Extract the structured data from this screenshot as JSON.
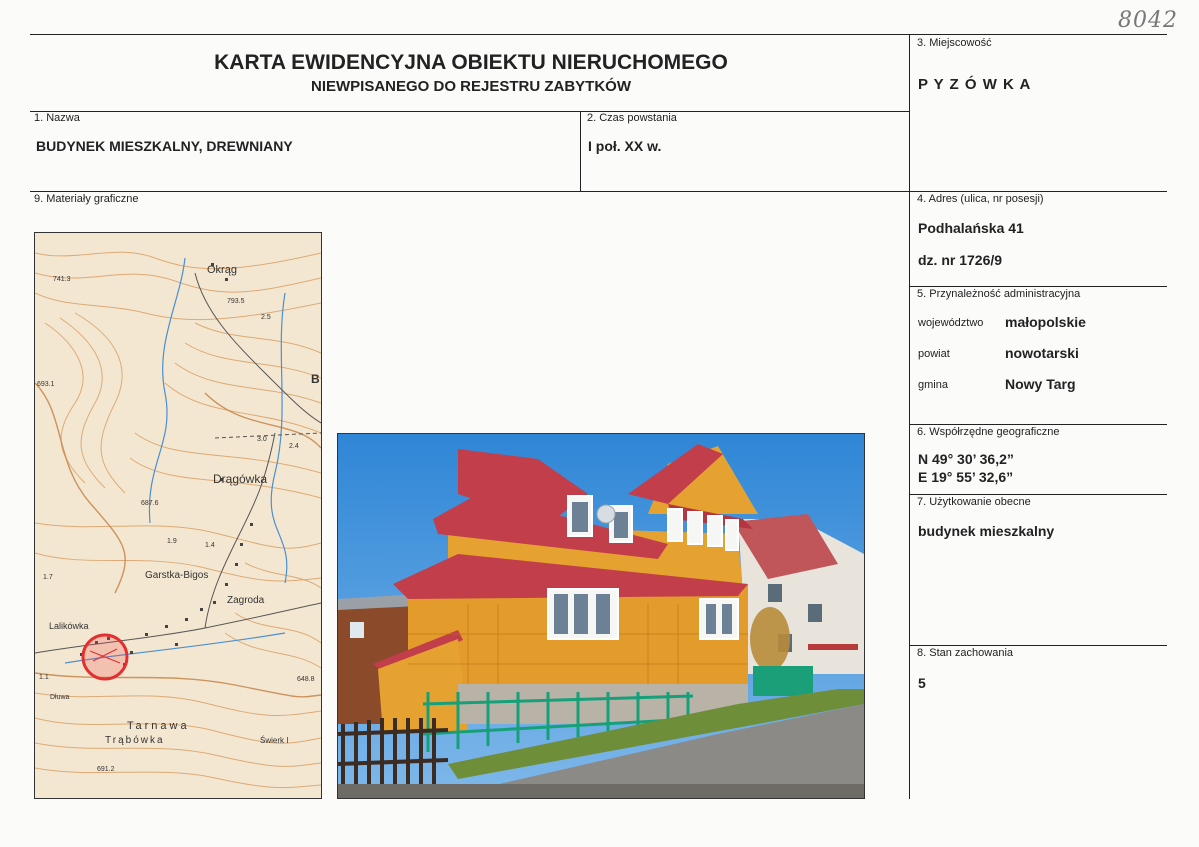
{
  "handwritten_number": "8042",
  "header": {
    "title_line1": "KARTA EWIDENCYJNA OBIEKTU NIERUCHOMEGO",
    "title_line2": "NIEWPISANEGO DO REJESTRU ZABYTKÓW"
  },
  "fields": {
    "nazwa": {
      "label": "1. Nazwa",
      "value": "BUDYNEK MIESZKALNY, DREWNIANY"
    },
    "czas": {
      "label": "2. Czas powstania",
      "value": "I poł. XX w."
    },
    "miejscowosc": {
      "label": "3. Miejscowość",
      "value": "P Y Z Ó W K A"
    },
    "adres": {
      "label": "4. Adres (ulica, nr posesji)",
      "line1": "Podhalańska 41",
      "line2": "dz. nr 1726/9"
    },
    "przynaleznosc": {
      "label": "5. Przynależność administracyjna",
      "rows": [
        {
          "key": "województwo",
          "value": "małopolskie"
        },
        {
          "key": "powiat",
          "value": "nowotarski"
        },
        {
          "key": "gmina",
          "value": "Nowy Targ"
        }
      ]
    },
    "wspolrzedne": {
      "label": "6. Współrzędne geograficzne",
      "n": "N 49° 30’ 36,2”",
      "e": "E 19° 55’ 32,6”"
    },
    "uzytkowanie": {
      "label": "7. Użytkowanie obecne",
      "value": "budynek mieszkalny"
    },
    "stan": {
      "label": "8. Stan zachowania",
      "value": "5"
    },
    "materialy": {
      "label": "9. Materiały graficzne"
    }
  },
  "map": {
    "place_labels": [
      "Okrąg",
      "Drągówka",
      "Garstka-Bigos",
      "Zagroda",
      "Lalikówka",
      "Tarnawa",
      "Trąbówka",
      "Świerk I",
      "Dłuwa"
    ],
    "numbers": [
      "741.3",
      "793.5",
      "2.5",
      "693.1",
      "3.0",
      "2.4",
      "687.6",
      "1.9",
      "1.4",
      "1.7",
      "648.8",
      "691.2",
      "1.1"
    ],
    "colors": {
      "contour": "#d9a066",
      "water": "#4a8fd0",
      "road": "#555555",
      "marker": "#e23030"
    }
  },
  "photo": {
    "colors": {
      "sky": "#3a8fd8",
      "roof": "#c9404a",
      "walls": "#e09a2a",
      "fence": "#1aa57a",
      "road": "#8c8a86"
    }
  }
}
